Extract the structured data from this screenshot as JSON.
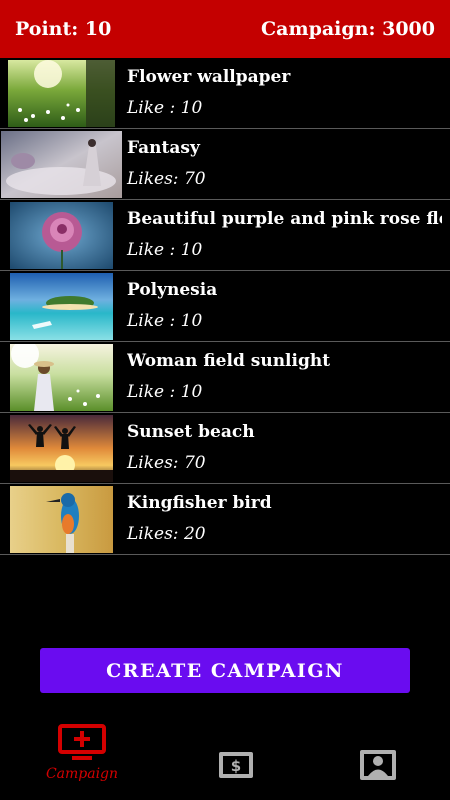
{
  "header": {
    "point_label": "Point: 10",
    "campaign_label": "Campaign: 3000"
  },
  "items": [
    {
      "title": "Flower wallpaper",
      "likes": "Like : 10"
    },
    {
      "title": "Fantasy",
      "likes": "Likes: 70"
    },
    {
      "title": "Beautiful purple and pink rose flo..",
      "likes": "Like : 10"
    },
    {
      "title": "Polynesia",
      "likes": "Like : 10"
    },
    {
      "title": "Woman field sunlight",
      "likes": "Like : 10"
    },
    {
      "title": "Sunset beach",
      "likes": "Likes: 70"
    },
    {
      "title": "Kingfisher bird",
      "likes": "Likes: 20"
    }
  ],
  "create_button": {
    "label": "CREATE CAMPAIGN"
  },
  "nav": {
    "campaign_label": "Campaign",
    "campaign_icon": "monitor-plus-icon",
    "earn_icon": "dollar-icon",
    "profile_icon": "contact-card-icon"
  },
  "colors": {
    "header": "#c40000",
    "button": "#6a0cf0",
    "nav_active": "#d40000",
    "nav_inactive": "#b0b0b0"
  }
}
